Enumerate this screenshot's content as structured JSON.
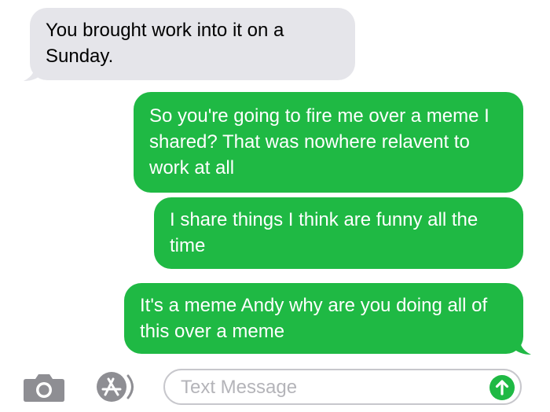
{
  "conversation": {
    "messages": [
      {
        "direction": "received",
        "text": "You brought work into it on a Sunday."
      },
      {
        "direction": "sent",
        "text": "So you're going to fire me over a meme I shared? That was nowhere relavent to work at all"
      },
      {
        "direction": "sent",
        "text": "I share things I think are funny all the time"
      },
      {
        "direction": "sent",
        "text": "It's a meme Andy why are you doing all of this over a meme"
      }
    ]
  },
  "composer": {
    "placeholder": "Text Message",
    "value": "",
    "icons": {
      "camera": "camera-icon",
      "apps": "app-store-icon",
      "send": "send-arrow-icon"
    }
  },
  "colors": {
    "sent_bubble": "#1fb944",
    "received_bubble": "#e5e5ea",
    "icon_gray": "#8e8e93",
    "field_border": "#c7c7cc",
    "placeholder": "#b4b4b9"
  }
}
